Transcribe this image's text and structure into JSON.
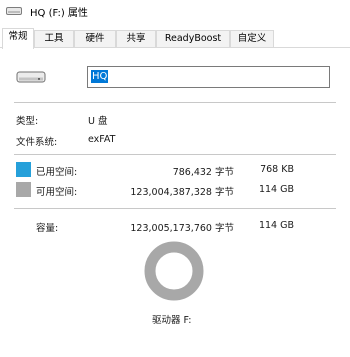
{
  "window": {
    "title": "HQ (F:) 属性",
    "icon": "drive-icon"
  },
  "tabs": [
    {
      "label": "常规"
    },
    {
      "label": "工具"
    },
    {
      "label": "硬件"
    },
    {
      "label": "共享"
    },
    {
      "label": "ReadyBoost"
    },
    {
      "label": "自定义"
    }
  ],
  "general": {
    "drive_name_value": "HQ",
    "type_label": "类型:",
    "type_value": "U 盘",
    "filesystem_label": "文件系统:",
    "filesystem_value": "exFAT",
    "used": {
      "label": "已用空间:",
      "bytes": "786,432 字节",
      "size": "768 KB",
      "color": "#26a0da"
    },
    "free": {
      "label": "可用空间:",
      "bytes": "123,004,387,328 字节",
      "size": "114 GB",
      "color": "#a8a8a8"
    },
    "capacity": {
      "label": "容量:",
      "bytes": "123,005,173,760 字节",
      "size": "114 GB"
    },
    "drive_label": "驱动器 F:",
    "usage_fraction": 6.4e-06
  }
}
